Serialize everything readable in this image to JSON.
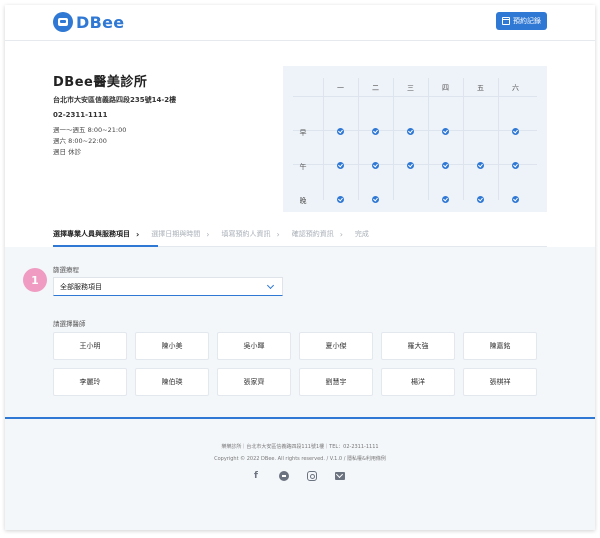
{
  "header": {
    "logo_text": "DBee",
    "booking_button": "預約記錄"
  },
  "clinic": {
    "name": "DBee醫美診所",
    "address": "台北市大安區信義路四段235號14-2樓",
    "phone": "02-2311-1111",
    "hours": [
      "週一～週五 8:00~21:00",
      "週六 8:00~22:00",
      "週日 休診"
    ]
  },
  "schedule": {
    "days": [
      "一",
      "二",
      "三",
      "四",
      "五",
      "六"
    ],
    "periods": [
      {
        "label": "早",
        "available": [
          true,
          true,
          true,
          true,
          false,
          true
        ]
      },
      {
        "label": "午",
        "available": [
          true,
          true,
          true,
          true,
          true,
          true
        ]
      },
      {
        "label": "晚",
        "available": [
          true,
          true,
          false,
          true,
          true,
          true
        ]
      }
    ]
  },
  "steps": [
    {
      "label": "選擇專業人員與服務項目",
      "active": true
    },
    {
      "label": "選擇日期與時間",
      "active": false
    },
    {
      "label": "填寫預約人資訊",
      "active": false
    },
    {
      "label": "確認預約資訊",
      "active": false
    },
    {
      "label": "完成",
      "active": false
    }
  ],
  "step_number": "1",
  "filter": {
    "label": "篩選療程",
    "selected": "全部服務項目"
  },
  "doctors": {
    "label": "請選擇醫師",
    "list": [
      "王小明",
      "陳小美",
      "吳小暉",
      "夏小傑",
      "羅大強",
      "陳嘉銘",
      "李麗玲",
      "陳伯瑛",
      "張家齊",
      "劉慧宇",
      "楊洋",
      "張棋祥"
    ]
  },
  "footer": {
    "address": "樂樂診所｜台北市大安區信義路四段111號1樓｜TEL：02-2311-1111",
    "copyright": "Copyright © 2022 DBee. All rights reserved. / V.1.0 / 隱私權&利用條例",
    "socials": [
      "facebook-icon",
      "line-icon",
      "instagram-icon",
      "mail-icon"
    ]
  },
  "colors": {
    "accent": "#2f78d4",
    "badge": "#ef9bc2"
  }
}
